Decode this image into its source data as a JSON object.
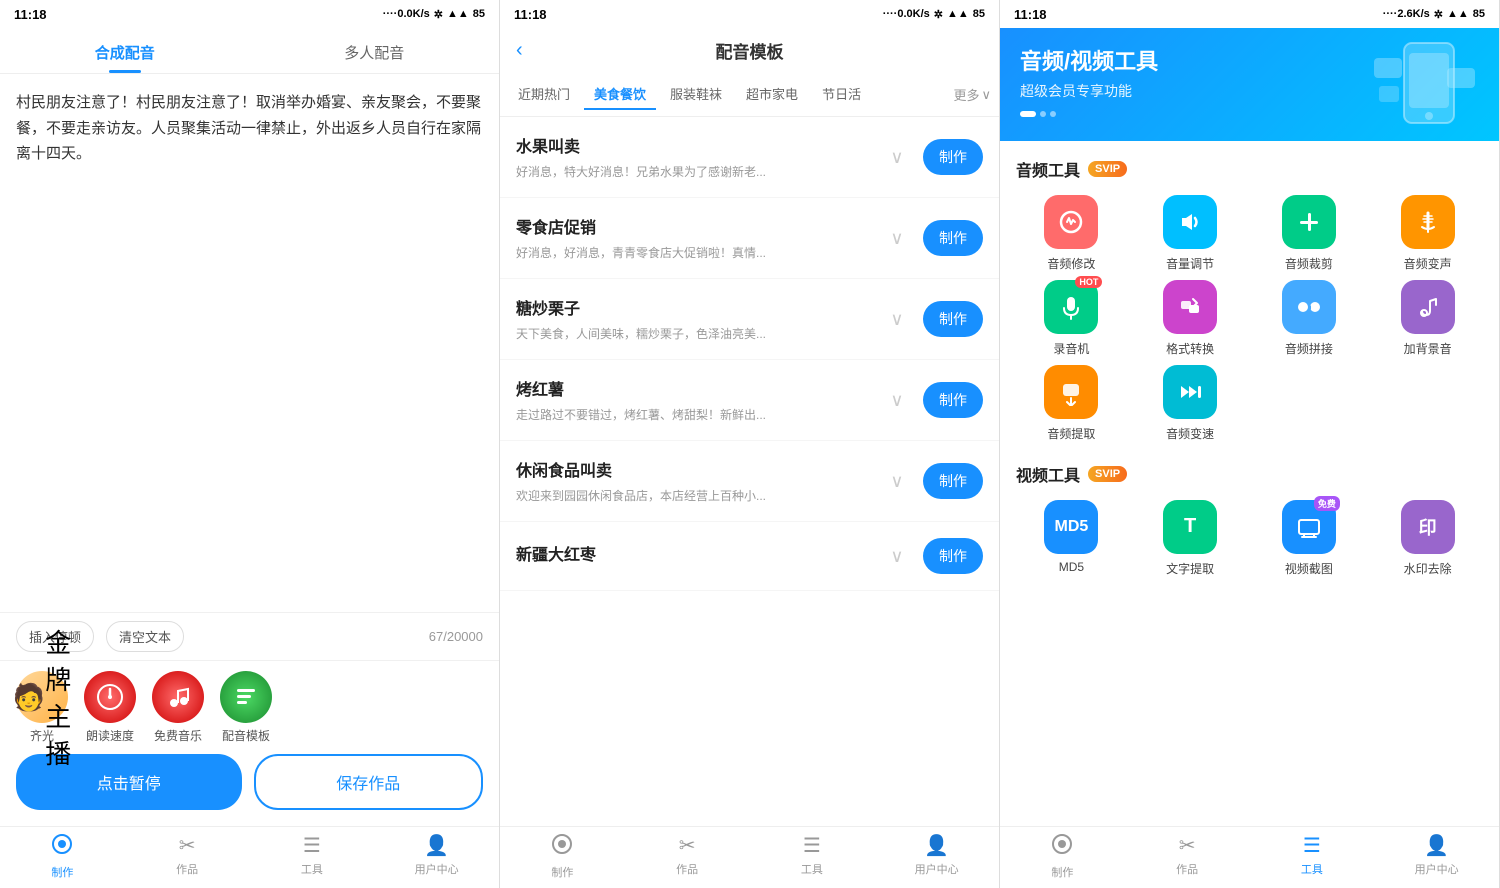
{
  "panel1": {
    "status": {
      "time": "11:18",
      "signal": "....0.0K/s",
      "battery": "85"
    },
    "tabs": [
      "合成配音",
      "多人配音"
    ],
    "active_tab": 0,
    "text_content": "村民朋友注意了！村民朋友注意了！取消举办婚宴、亲友聚会，不要聚餐，不要走亲访友。人员聚集活动一律禁止，外出返乡人员自行在家隔离十四天。",
    "toolbar": {
      "insert_btn": "插入停顿",
      "clear_btn": "清空文本",
      "char_count": "67/20000"
    },
    "voice_items": [
      {
        "name": "齐光",
        "badge": "金牌主播"
      },
      {
        "name": "朗读速度",
        "icon": "🔴"
      },
      {
        "name": "免费音乐",
        "icon": "🔴"
      },
      {
        "name": "配音模板",
        "icon": "🟢"
      }
    ],
    "buttons": {
      "pause": "点击暂停",
      "save": "保存作品"
    },
    "nav": [
      {
        "label": "制作",
        "active": true
      },
      {
        "label": "作品",
        "active": false
      },
      {
        "label": "工具",
        "active": false
      },
      {
        "label": "用户中心",
        "active": false
      }
    ]
  },
  "panel2": {
    "status": {
      "time": "11:18",
      "signal": "....0.0K/s",
      "battery": "85"
    },
    "title": "配音模板",
    "back_icon": "‹",
    "categories": [
      {
        "label": "近期热门",
        "active": false
      },
      {
        "label": "美食餐饮",
        "active": true
      },
      {
        "label": "服装鞋袜",
        "active": false
      },
      {
        "label": "超市家电",
        "active": false
      },
      {
        "label": "节日活",
        "active": false
      }
    ],
    "more_label": "更多",
    "templates": [
      {
        "name": "水果叫卖",
        "desc": "好消息，特大好消息！兄弟水果为了感谢新老...",
        "action": "制作"
      },
      {
        "name": "零食店促销",
        "desc": "好消息，好消息，青青零食店大促销啦！真情...",
        "action": "制作"
      },
      {
        "name": "糖炒栗子",
        "desc": "天下美食，人间美味，糯炒栗子，色泽油亮美...",
        "action": "制作"
      },
      {
        "name": "烤红薯",
        "desc": "走过路过不要错过，烤红薯、烤甜梨！新鲜出...",
        "action": "制作"
      },
      {
        "name": "休闲食品叫卖",
        "desc": "欢迎来到园园休闲食品店，本店经营上百种小...",
        "action": "制作"
      },
      {
        "name": "新疆大红枣",
        "desc": "",
        "action": "制作"
      }
    ],
    "nav": [
      {
        "label": "制作",
        "active": false
      },
      {
        "label": "作品",
        "active": false
      },
      {
        "label": "工具",
        "active": false
      },
      {
        "label": "用户中心",
        "active": false
      }
    ]
  },
  "panel3": {
    "status": {
      "time": "11:18",
      "signal": "....2.6K/s",
      "battery": "85"
    },
    "banner": {
      "line1": "音频/视频工具",
      "line2": "超级会员专享功能"
    },
    "audio_section": {
      "title": "音频工具",
      "badge": "SVIP",
      "tools": [
        {
          "label": "音频修改",
          "color": "#ff6b6b",
          "icon": "⚙️"
        },
        {
          "label": "音量调节",
          "color": "#00bfff",
          "icon": "🔊"
        },
        {
          "label": "音频裁剪",
          "color": "#00cc88",
          "icon": "✂️"
        },
        {
          "label": "音频变声",
          "color": "#ff9500",
          "icon": "🎤"
        },
        {
          "label": "录音机",
          "color": "#00cc88",
          "icon": "🎙️",
          "hot": true
        },
        {
          "label": "格式转换",
          "color": "#cc44cc",
          "icon": "🔄"
        },
        {
          "label": "音频拼接",
          "color": "#44aaff",
          "icon": "🧩"
        },
        {
          "label": "加背景音",
          "color": "#9966cc",
          "icon": "🎵"
        },
        {
          "label": "音频提取",
          "color": "#ff8c00",
          "icon": "📂"
        },
        {
          "label": "音频变速",
          "color": "#00bcd4",
          "icon": "⏩"
        }
      ]
    },
    "video_section": {
      "title": "视频工具",
      "badge": "SVIP",
      "tools": [
        {
          "label": "MD5",
          "color": "#1890ff",
          "icon": "M",
          "free": false
        },
        {
          "label": "T",
          "color": "#00cc88",
          "icon": "T",
          "free": false
        },
        {
          "label": "视频",
          "color": "#1890ff",
          "icon": "🖼️",
          "free": true
        },
        {
          "label": "印",
          "color": "#9966cc",
          "icon": "印",
          "free": false
        }
      ]
    },
    "nav": [
      {
        "label": "制作",
        "active": false
      },
      {
        "label": "作品",
        "active": false
      },
      {
        "label": "工具",
        "active": true
      },
      {
        "label": "用户中心",
        "active": false
      }
    ]
  }
}
